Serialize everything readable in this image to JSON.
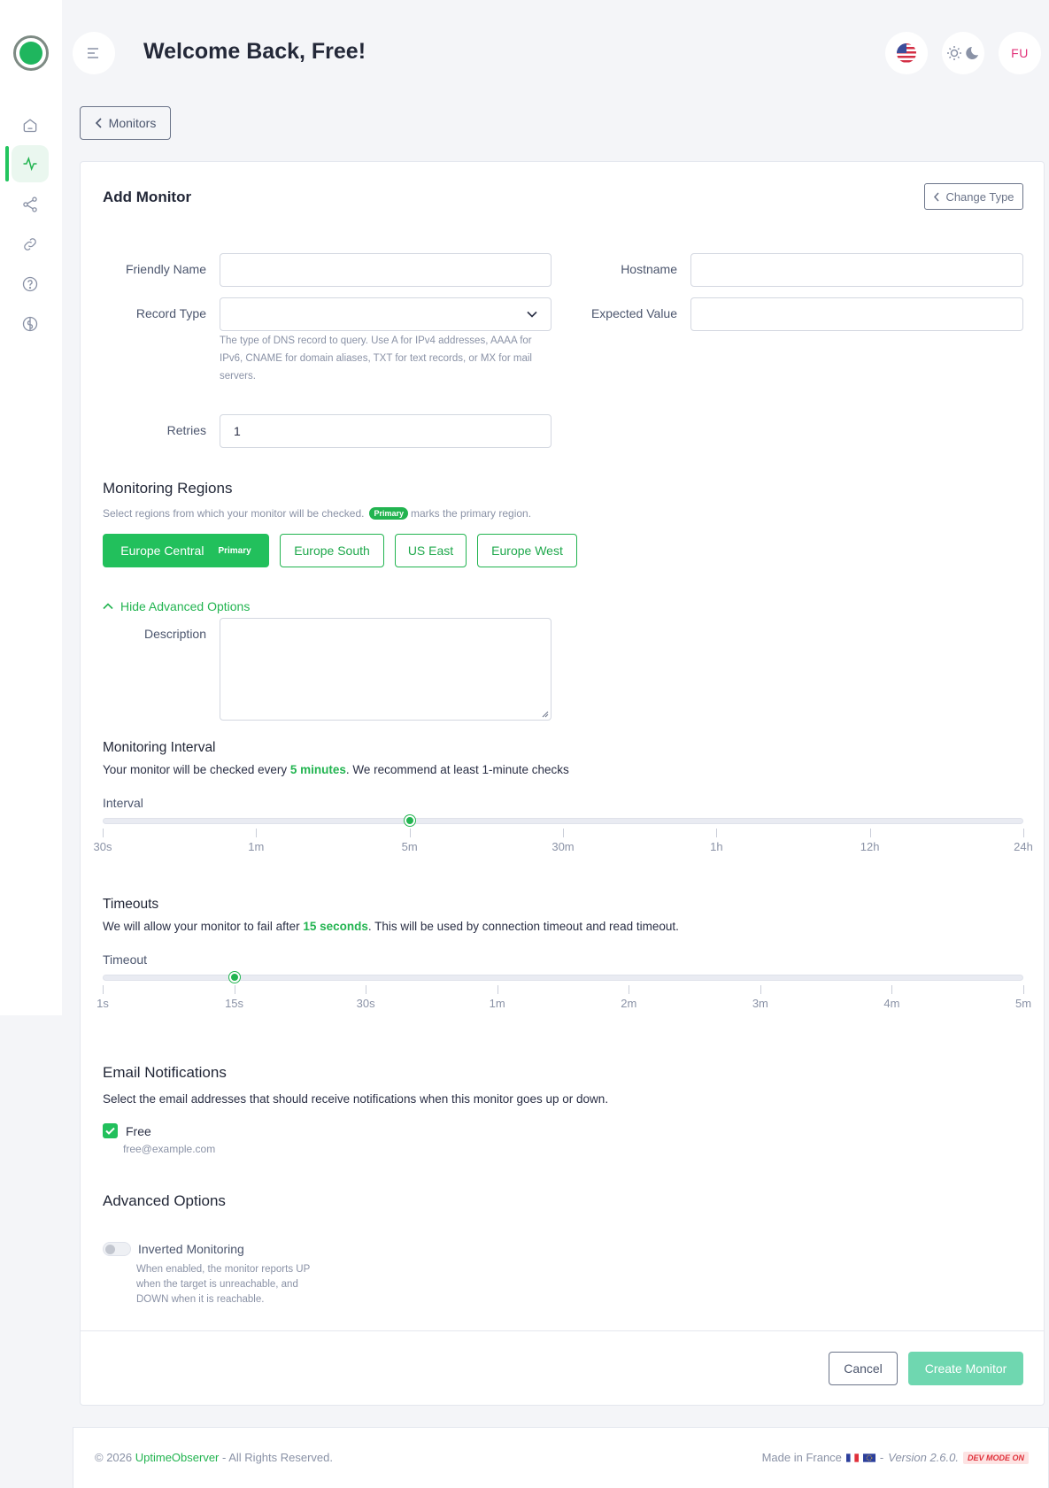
{
  "header": {
    "welcome": "Welcome Back, Free!",
    "avatar_initials": "FU",
    "language_icon": "us-flag-icon",
    "theme_icon": "sun-moon-icon"
  },
  "sidebar": {
    "items": [
      {
        "name": "home-icon"
      },
      {
        "name": "activity-icon",
        "active": true
      },
      {
        "name": "share-icon"
      },
      {
        "name": "link-icon"
      },
      {
        "name": "help-icon"
      },
      {
        "name": "brain-icon"
      }
    ]
  },
  "nav": {
    "back_label": "Monitors"
  },
  "card": {
    "title": "Add Monitor",
    "change_type_label": "Change Type"
  },
  "form": {
    "friendly_name": {
      "label": "Friendly Name",
      "value": ""
    },
    "hostname": {
      "label": "Hostname",
      "value": ""
    },
    "record_type": {
      "label": "Record Type",
      "value": "",
      "help": "The type of DNS record to query. Use A for IPv4 addresses, AAAA for IPv6, CNAME for domain aliases, TXT for text records, or MX for mail servers."
    },
    "expected_value": {
      "label": "Expected Value",
      "value": ""
    },
    "retries": {
      "label": "Retries",
      "value": "1"
    },
    "description": {
      "label": "Description",
      "value": ""
    }
  },
  "regions": {
    "title": "Monitoring Regions",
    "hint_before": "Select regions from which your monitor will be checked.",
    "hint_badge": "Primary",
    "hint_after": "marks the primary region.",
    "items": [
      {
        "label": "Europe Central",
        "selected": true,
        "tag": "Primary"
      },
      {
        "label": "Europe South",
        "selected": false
      },
      {
        "label": "US East",
        "selected": false
      },
      {
        "label": "Europe West",
        "selected": false
      }
    ]
  },
  "advanced_toggle": "Hide Advanced Options",
  "interval": {
    "title": "Monitoring Interval",
    "text_before": "Your monitor will be checked every",
    "value_text": "5 minutes",
    "text_after": ". We recommend at least 1-minute checks",
    "slider_label": "Interval",
    "value": "5m",
    "ticks": [
      "30s",
      "1m",
      "5m",
      "30m",
      "1h",
      "12h",
      "24h"
    ]
  },
  "timeout": {
    "title": "Timeouts",
    "text_before": "We will allow your monitor to fail after",
    "value_text": "15 seconds",
    "text_after": ". This will be used by connection timeout and read timeout.",
    "slider_label": "Timeout",
    "value": "15s",
    "ticks": [
      "1s",
      "15s",
      "30s",
      "1m",
      "2m",
      "3m",
      "4m",
      "5m"
    ]
  },
  "email": {
    "title": "Email Notifications",
    "subtitle": "Select the email addresses that should receive notifications when this monitor goes up or down.",
    "recipient_name": "Free",
    "recipient_email": "free@example.com",
    "checked": true
  },
  "advanced": {
    "title": "Advanced Options",
    "inverted_label": "Inverted Monitoring",
    "inverted_help": "When enabled, the monitor reports UP when the target is unreachable, and DOWN when it is reachable.",
    "inverted_enabled": false
  },
  "actions": {
    "cancel": "Cancel",
    "create": "Create Monitor"
  },
  "footer": {
    "copyright_prefix": "© 2026",
    "brand": "UptimeObserver",
    "copyright_suffix": "- All Rights Reserved.",
    "made_in": "Made in France",
    "separator": "-",
    "version": "Version 2.6.0.",
    "dev_badge": "DEV MODE ON"
  },
  "colors": {
    "accent": "#22b450",
    "accent_light": "#6fd7b0",
    "brand_pink": "#e2337a",
    "danger": "#e0303a"
  }
}
